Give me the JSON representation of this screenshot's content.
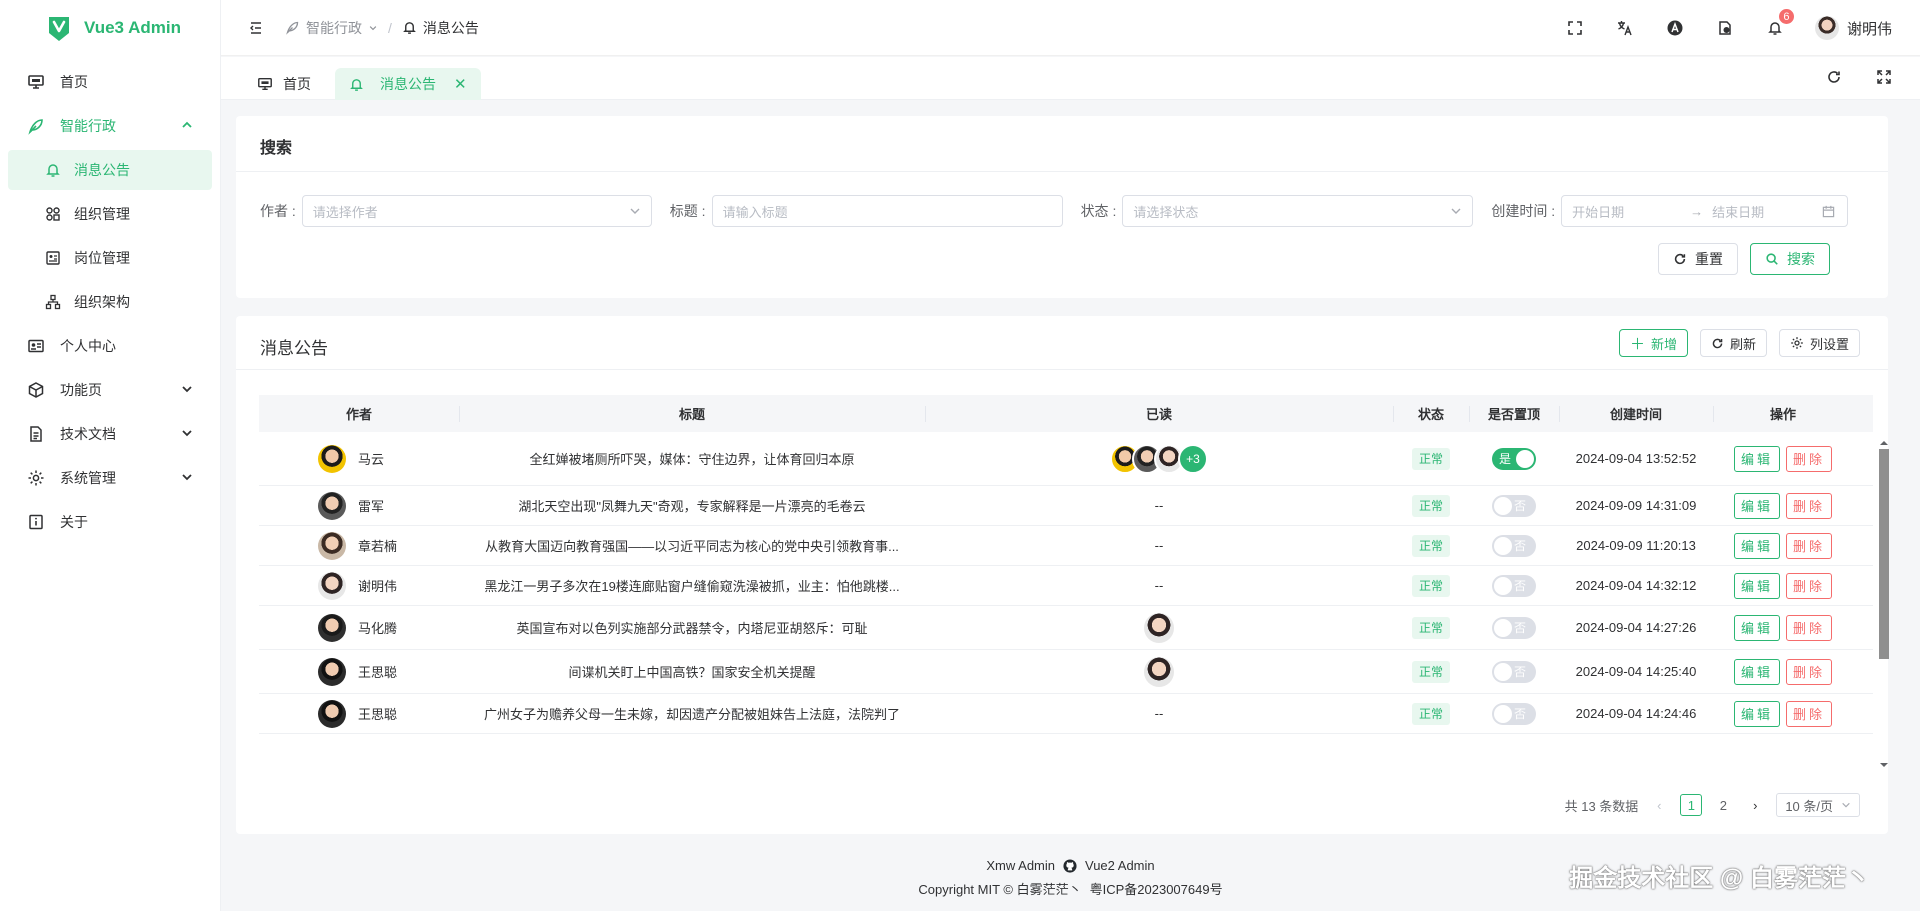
{
  "app": {
    "name": "Vue3 Admin",
    "brand_color": "#2bb673"
  },
  "sidebar": {
    "items": [
      {
        "label": "首页",
        "icon": "monitor-icon"
      },
      {
        "label": "智能行政",
        "icon": "feather-icon",
        "expanded": true,
        "children": [
          {
            "label": "消息公告",
            "icon": "bell-icon",
            "active": true
          },
          {
            "label": "组织管理",
            "icon": "org-icon"
          },
          {
            "label": "岗位管理",
            "icon": "id-card-icon"
          },
          {
            "label": "组织架构",
            "icon": "hierarchy-icon"
          }
        ]
      },
      {
        "label": "个人中心",
        "icon": "profile-card-icon"
      },
      {
        "label": "功能页",
        "icon": "box-icon"
      },
      {
        "label": "技术文档",
        "icon": "document-icon"
      },
      {
        "label": "系统管理",
        "icon": "gear-icon"
      },
      {
        "label": "关于",
        "icon": "info-icon"
      }
    ]
  },
  "header": {
    "breadcrumb": [
      "智能行政",
      "消息公告"
    ],
    "notification_count": "6",
    "user_name": "谢明伟"
  },
  "tabs": [
    {
      "label": "首页"
    },
    {
      "label": "消息公告",
      "active": true
    }
  ],
  "search": {
    "title": "搜索",
    "author_label": "作者 :",
    "author_placeholder": "请选择作者",
    "title_label": "标题 :",
    "title_placeholder": "请输入标题",
    "status_label": "状态 :",
    "status_placeholder": "请选择状态",
    "created_label": "创建时间 :",
    "start_placeholder": "开始日期",
    "end_placeholder": "结束日期",
    "reset_label": "重置",
    "search_label": "搜索"
  },
  "table_card": {
    "title": "消息公告",
    "add_label": "新增",
    "refresh_label": "刷新",
    "columns_label": "列设置",
    "columns": [
      "作者",
      "标题",
      "已读",
      "状态",
      "是否置顶",
      "创建时间",
      "操作"
    ],
    "edit_label": "编辑",
    "delete_label": "删除",
    "rows": [
      {
        "author": "马云",
        "title": "全红婵被堵厕所吓哭，媒体：守住边界，让体育回归本原",
        "read": "avatars",
        "read_more": "+3",
        "status": "正常",
        "top": "是",
        "top_on": true,
        "time": "2024-09-04 13:52:52"
      },
      {
        "author": "雷军",
        "title": "湖北天空出现\"凤舞九天\"奇观，专家解释是一片漂亮的毛卷云",
        "read": "--",
        "status": "正常",
        "top": "否",
        "top_on": false,
        "time": "2024-09-09 14:31:09"
      },
      {
        "author": "章若楠",
        "title": "从教育大国迈向教育强国——以习近平同志为核心的党中央引领教育事...",
        "read": "--",
        "status": "正常",
        "top": "否",
        "top_on": false,
        "time": "2024-09-09 11:20:13"
      },
      {
        "author": "谢明伟",
        "title": "黑龙江一男子多次在19楼连廊贴窗户缝偷窥洗澡被抓，业主：怕他跳楼...",
        "read": "--",
        "status": "正常",
        "top": "否",
        "top_on": false,
        "time": "2024-09-04 14:32:12"
      },
      {
        "author": "马化腾",
        "title": "英国宣布对以色列实施部分武器禁令，内塔尼亚胡怒斥：可耻",
        "read": "avatar",
        "status": "正常",
        "top": "否",
        "top_on": false,
        "time": "2024-09-04 14:27:26"
      },
      {
        "author": "王思聪",
        "title": "间谍机关盯上中国高铁？国家安全机关提醒",
        "read": "avatar",
        "status": "正常",
        "top": "否",
        "top_on": false,
        "time": "2024-09-04 14:25:40"
      },
      {
        "author": "王思聪",
        "title": "广州女子为赡养父母一生未嫁，却因遗产分配被姐妹告上法庭，法院判了",
        "read": "--",
        "status": "正常",
        "top": "否",
        "top_on": false,
        "time": "2024-09-04 14:24:46"
      }
    ]
  },
  "pagination": {
    "total_text": "共 13 条数据",
    "pages": [
      "1",
      "2"
    ],
    "current": "1",
    "page_size": "10 条/页"
  },
  "footer": {
    "link1": "Xmw Admin",
    "link2": "Vue2 Admin",
    "copyright": "Copyright MIT ©  白雾茫茫丶",
    "icp": "粤ICP备2023007649号"
  },
  "watermark": "掘金技术社区 @ 白雾茫茫丶"
}
